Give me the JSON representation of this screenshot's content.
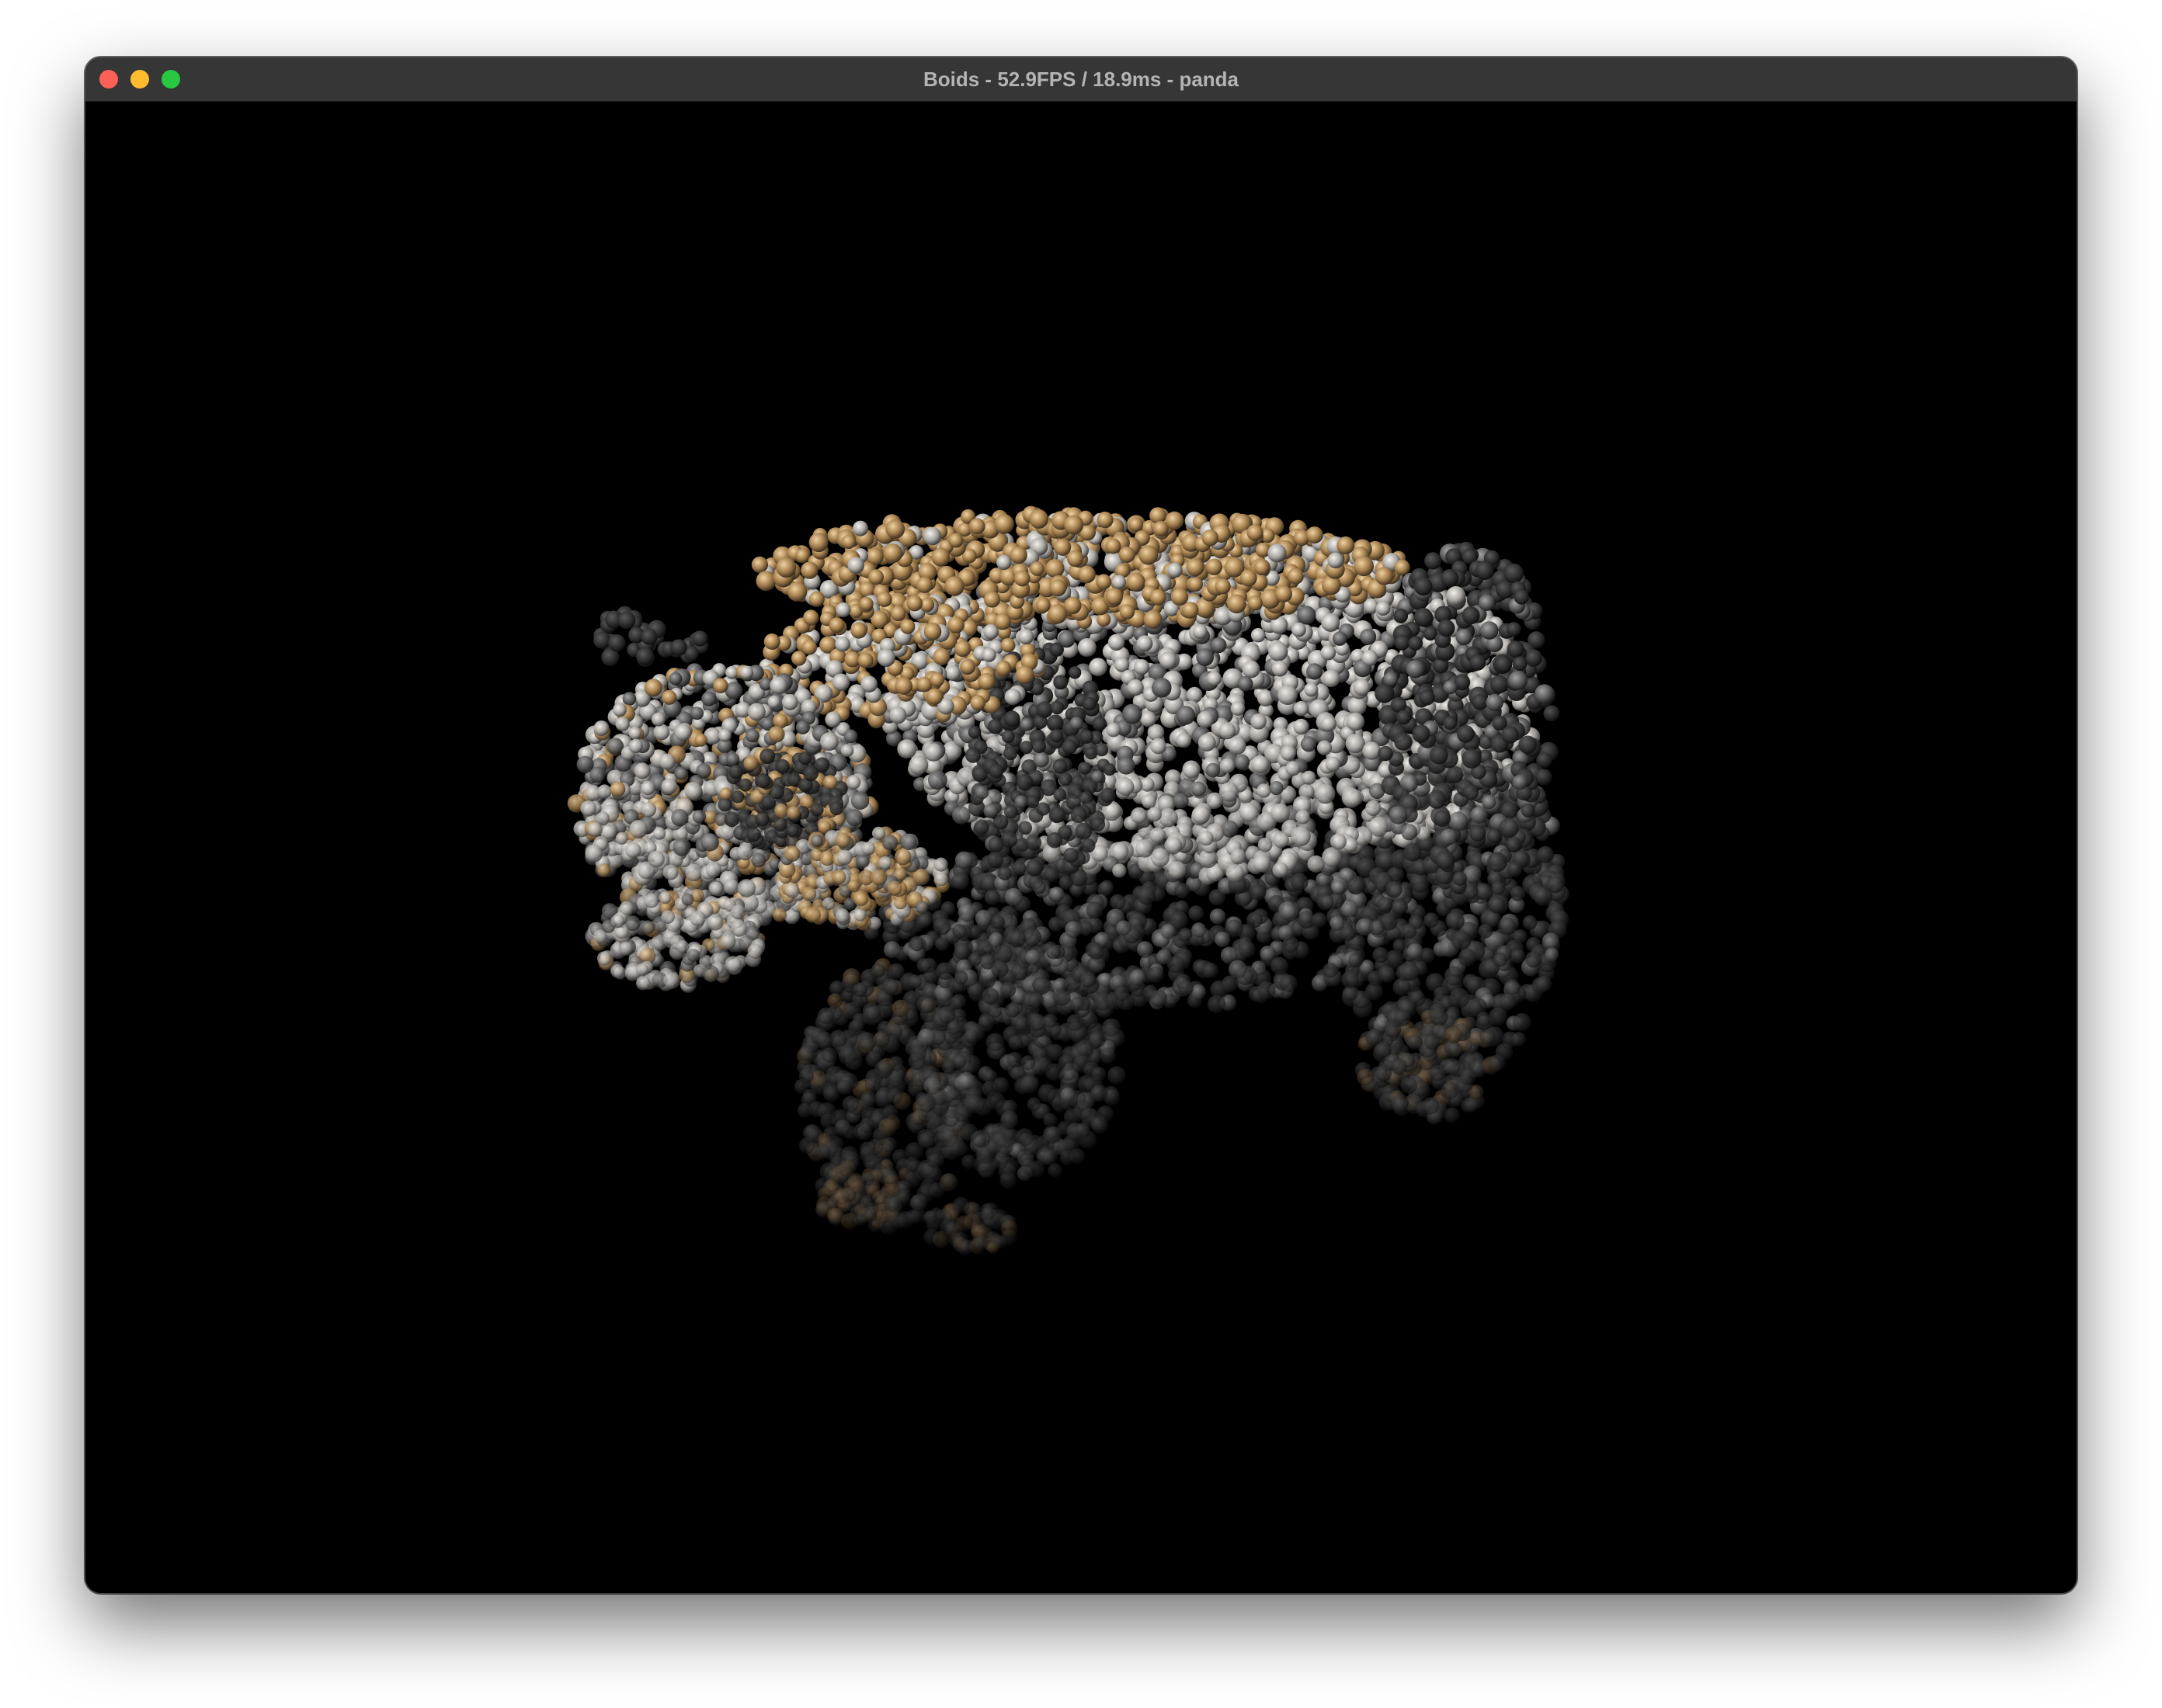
{
  "window": {
    "title": "Boids - 52.9FPS / 18.9ms - panda",
    "controls": [
      {
        "name": "close-button",
        "color": "#fe5f57"
      },
      {
        "name": "minimize-button",
        "color": "#febc2e"
      },
      {
        "name": "zoom-button",
        "color": "#28c840"
      }
    ]
  },
  "scene": {
    "background": "#000000",
    "subject": "panda",
    "palette": {
      "white": "#d9d6d1",
      "tan": "#c9a06a",
      "dark": "#3a3a3a"
    }
  }
}
